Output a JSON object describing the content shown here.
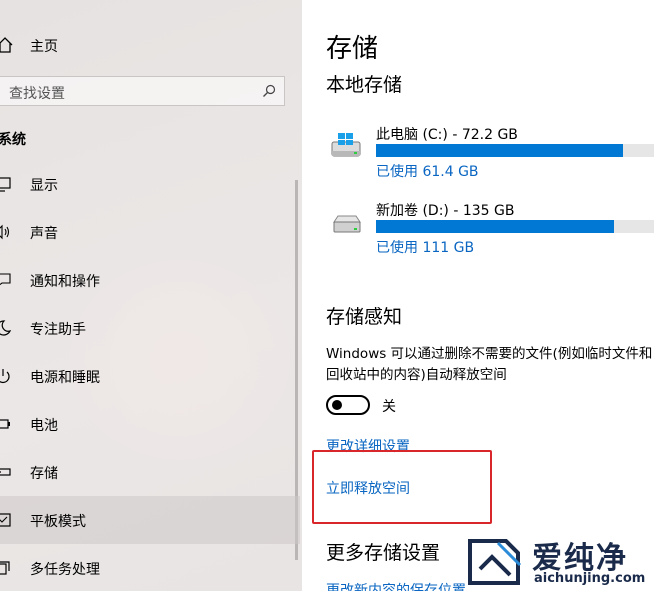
{
  "sidebar": {
    "home_label": "主页",
    "search_placeholder": "查找设置",
    "section_title": "系统",
    "items": [
      {
        "label": "显示",
        "icon": "display-icon"
      },
      {
        "label": "声音",
        "icon": "sound-icon"
      },
      {
        "label": "通知和操作",
        "icon": "notification-icon"
      },
      {
        "label": "专注助手",
        "icon": "moon-icon"
      },
      {
        "label": "电源和睡眠",
        "icon": "power-icon"
      },
      {
        "label": "电池",
        "icon": "battery-icon"
      },
      {
        "label": "存储",
        "icon": "storage-icon"
      },
      {
        "label": "平板模式",
        "icon": "tablet-icon",
        "selected": true
      },
      {
        "label": "多任务处理",
        "icon": "multitask-icon"
      }
    ]
  },
  "main": {
    "title": "存储",
    "local_storage_heading": "本地存储",
    "drives": [
      {
        "name": "此电脑 (C:) - 72.2 GB",
        "used": "已使用 61.4 GB",
        "fraction_used": 0.85,
        "icon": "windows-drive-icon"
      },
      {
        "name": "新加卷 (D:) - 135 GB",
        "used": "已使用 111 GB",
        "fraction_used": 0.82,
        "icon": "drive-icon"
      }
    ],
    "storage_sense_heading": "存储感知",
    "storage_sense_desc": "Windows 可以通过删除不需要的文件(例如临时文件和回收站中的内容)自动释放空间",
    "toggle_label": "关",
    "toggle_on": false,
    "link_change_settings": "更改详细设置",
    "link_free_space": "立即释放空间",
    "more_heading": "更多存储设置",
    "link_partial": "更改新内容的保存位置"
  },
  "watermark": {
    "cn": "爱纯净",
    "url": "aichunjing.com"
  },
  "colors": {
    "accent": "#0078d4",
    "link": "#0a66c2",
    "highlight_box": "#d9262b"
  }
}
